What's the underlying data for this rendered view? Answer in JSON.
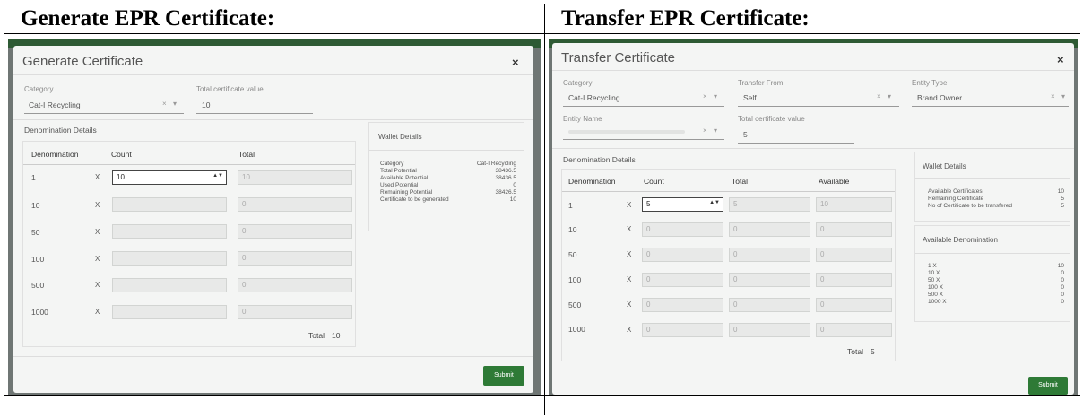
{
  "left": {
    "heading": "Generate EPR Certificate:",
    "modal_title": "Generate Certificate",
    "close_glyph": "×",
    "category_label": "Category",
    "category_value": "Cat-I Recycling",
    "total_value_label": "Total certificate value",
    "total_value": "10",
    "denomination_details": "Denomination Details",
    "table_headers": [
      "Denomination",
      "Count",
      "Total"
    ],
    "rows": [
      {
        "denomination": "1",
        "x": "X",
        "count": "10",
        "total": "10"
      },
      {
        "denomination": "10",
        "x": "X",
        "count": "",
        "total": "0"
      },
      {
        "denomination": "50",
        "x": "X",
        "count": "",
        "total": "0"
      },
      {
        "denomination": "100",
        "x": "X",
        "count": "",
        "total": "0"
      },
      {
        "denomination": "500",
        "x": "X",
        "count": "",
        "total": "0"
      },
      {
        "denomination": "1000",
        "x": "X",
        "count": "",
        "total": "0"
      }
    ],
    "grand_total_label": "Total",
    "grand_total": "10",
    "wallet_title": "Wallet Details",
    "wallet_rows": [
      {
        "label": "Category",
        "value": "Cat-I Recycling"
      },
      {
        "label": "Total Potential",
        "value": "38436.5"
      },
      {
        "label": "Available Potential",
        "value": "38436.5"
      },
      {
        "label": "Used Potential",
        "value": "0"
      },
      {
        "label": "Remaining Potential",
        "value": "38426.5"
      },
      {
        "label": "Certificate to be generated",
        "value": "10"
      }
    ],
    "submit_label": "Submit"
  },
  "right": {
    "heading": "Transfer EPR Certificate:",
    "modal_title": "Transfer Certificate",
    "close_glyph": "×",
    "category_label": "Category",
    "category_value": "Cat-I Recycling",
    "transfer_from_label": "Transfer From",
    "transfer_from_value": "Self",
    "entity_type_label": "Entity Type",
    "entity_type_value": "Brand Owner",
    "entity_name_label": "Entity Name",
    "total_value_label": "Total certificate value",
    "total_value": "5",
    "denomination_details": "Denomination Details",
    "table_headers": [
      "Denomination",
      "Count",
      "Total",
      "Available"
    ],
    "rows": [
      {
        "denomination": "1",
        "x": "X",
        "count": "5",
        "total": "5",
        "available": "10"
      },
      {
        "denomination": "10",
        "x": "X",
        "count": "0",
        "total": "0",
        "available": "0"
      },
      {
        "denomination": "50",
        "x": "X",
        "count": "0",
        "total": "0",
        "available": "0"
      },
      {
        "denomination": "100",
        "x": "X",
        "count": "0",
        "total": "0",
        "available": "0"
      },
      {
        "denomination": "500",
        "x": "X",
        "count": "0",
        "total": "0",
        "available": "0"
      },
      {
        "denomination": "1000",
        "x": "X",
        "count": "0",
        "total": "0",
        "available": "0"
      }
    ],
    "grand_total_label": "Total",
    "grand_total": "5",
    "wallet_title": "Wallet Details",
    "wallet_rows": [
      {
        "label": "Available Certificates",
        "value": "10"
      },
      {
        "label": "Remaining Certificate",
        "value": "5"
      },
      {
        "label": "No of Certificate to be transfered",
        "value": "5"
      }
    ],
    "avail_title": "Available Denomination",
    "avail_rows": [
      {
        "label": "1 X",
        "value": "10"
      },
      {
        "label": "10 X",
        "value": "0"
      },
      {
        "label": "50 X",
        "value": "0"
      },
      {
        "label": "100 X",
        "value": "0"
      },
      {
        "label": "500 X",
        "value": "0"
      },
      {
        "label": "1000 X",
        "value": "0"
      }
    ],
    "submit_label": "Submit"
  },
  "select_clear_glyph": "×",
  "select_arrow_glyph": "▾",
  "spinner_glyph": "▲▼",
  "colors": {
    "submit": "#2e7a36",
    "backdrop": "#6f7674",
    "header_bar": "#2e5a34"
  }
}
